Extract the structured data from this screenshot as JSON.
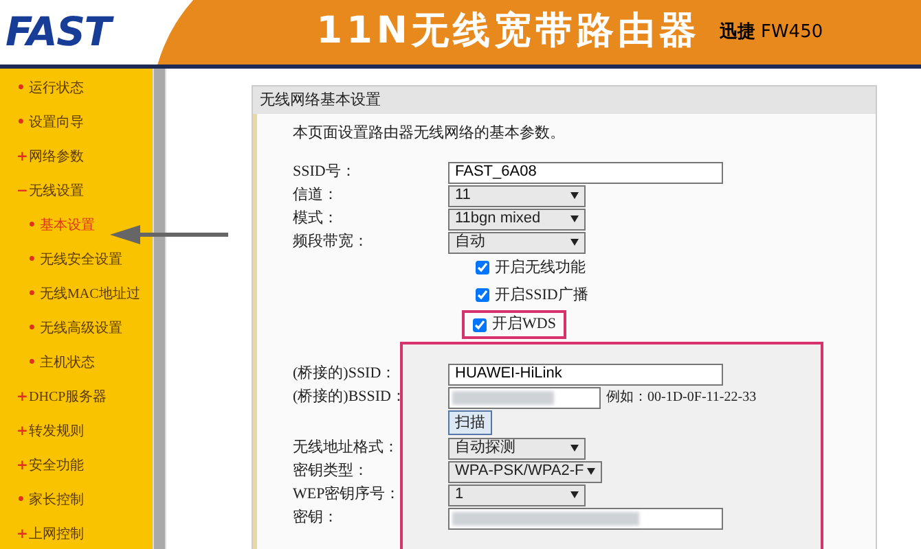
{
  "header": {
    "logo": "FAST",
    "title": "11N无线宽带路由器",
    "brand": "迅捷",
    "model": "FW450"
  },
  "sidebar": {
    "items": [
      {
        "marker": "•",
        "label": "运行状态",
        "selected": false
      },
      {
        "marker": "•",
        "label": "设置向导",
        "selected": false
      },
      {
        "marker": "+",
        "label": "网络参数",
        "selected": false
      },
      {
        "marker": "−",
        "label": "无线设置",
        "selected": false,
        "children": [
          {
            "marker": "•",
            "label": "基本设置",
            "selected": true
          },
          {
            "marker": "•",
            "label": "无线安全设置",
            "selected": false
          },
          {
            "marker": "•",
            "label": "无线MAC地址过",
            "selected": false
          },
          {
            "marker": "•",
            "label": "无线高级设置",
            "selected": false
          },
          {
            "marker": "•",
            "label": "主机状态",
            "selected": false
          }
        ]
      },
      {
        "marker": "+",
        "label": "DHCP服务器",
        "selected": false
      },
      {
        "marker": "+",
        "label": "转发规则",
        "selected": false
      },
      {
        "marker": "+",
        "label": "安全功能",
        "selected": false
      },
      {
        "marker": "•",
        "label": "家长控制",
        "selected": false
      },
      {
        "marker": "+",
        "label": "上网控制",
        "selected": false
      }
    ]
  },
  "panel": {
    "title": "无线网络基本设置",
    "intro": "本页面设置路由器无线网络的基本参数。",
    "fields": [
      {
        "kind": "text",
        "label": "SSID号：",
        "value": "FAST_6A08"
      },
      {
        "kind": "select",
        "label": "信道：",
        "value": "11"
      },
      {
        "kind": "select",
        "label": "模式：",
        "value": "11bgn mixed"
      },
      {
        "kind": "select",
        "label": "频段带宽：",
        "value": "自动"
      },
      {
        "kind": "checkbox",
        "label": "开启无线功能",
        "checked": true
      },
      {
        "kind": "checkbox",
        "label": "开启SSID广播",
        "checked": true
      },
      {
        "kind": "checkbox",
        "label": "开启WDS",
        "checked": true,
        "highlighted": true
      }
    ],
    "wds_fields": [
      {
        "kind": "text",
        "label": "(桥接的)SSID：",
        "value": "HUAWEI-HiLink"
      },
      {
        "kind": "hidden",
        "label": "(桥接的)BSSID：",
        "hint": "例如：00-1D-0F-11-22-33"
      },
      {
        "kind": "button",
        "label": "扫描"
      },
      {
        "kind": "select",
        "label": "无线地址格式：",
        "value": "自动探测"
      },
      {
        "kind": "select",
        "label": "密钥类型：",
        "value": "WPA-PSK/WPA2-F"
      },
      {
        "kind": "select",
        "label": "WEP密钥序号：",
        "value": "1"
      },
      {
        "kind": "hidden",
        "label": "密钥："
      }
    ]
  }
}
